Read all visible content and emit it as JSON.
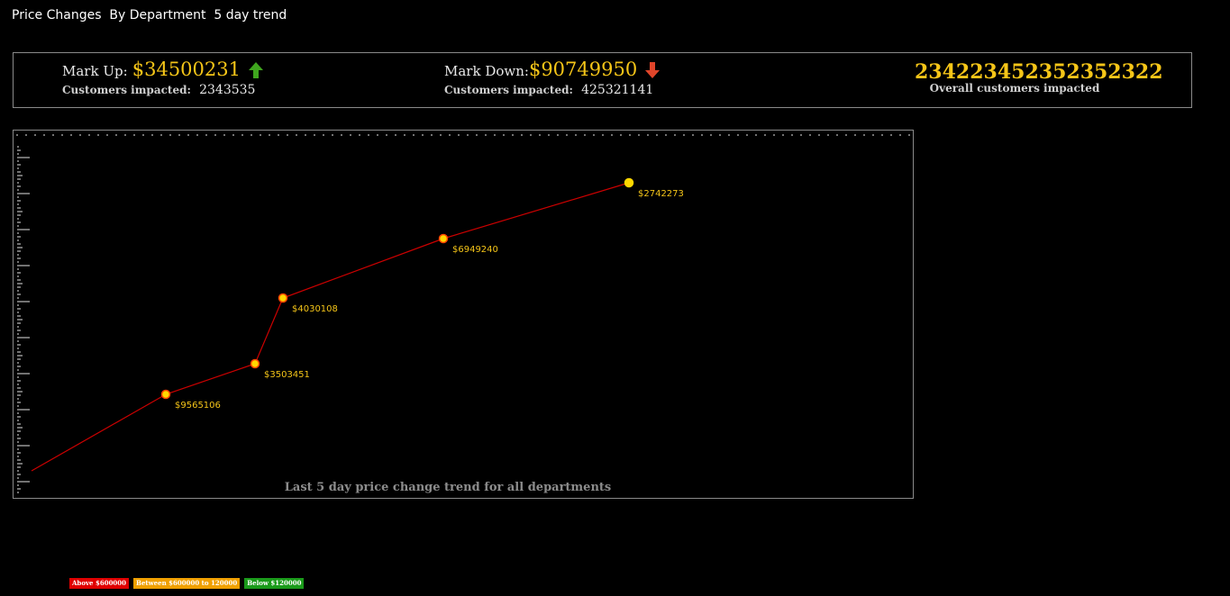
{
  "page": {
    "title": "Price Changes  By Department  5 day trend"
  },
  "summary": {
    "markup": {
      "label": "Mark Up:",
      "value": "$34500231",
      "customers_label": "Customers impacted:",
      "customers_value": "2343535",
      "arrow_color": "#3fa51e",
      "arrow_icon": "arrow-up-icon"
    },
    "markdown": {
      "label": "Mark Down:",
      "value": "$90749950",
      "customers_label": "Customers impacted:",
      "customers_value": "425321141",
      "arrow_color": "#e0452a",
      "arrow_icon": "arrow-down-icon"
    },
    "overall": {
      "value": "234223452352352322",
      "label": "Overall customers impacted"
    }
  },
  "chart_data": {
    "type": "line",
    "title": "Last 5 day price change trend for all departments",
    "xlabel": "",
    "ylabel": "",
    "grid": false,
    "line_color": "#cc0000",
    "point_fill": "#ffd700",
    "point_stroke": "#ff4400",
    "series": [
      {
        "values_plot_order": [
          0,
          1,
          2,
          3,
          4,
          5
        ],
        "labels": [
          "",
          "$9565106",
          "$3503451",
          "$4030108",
          "$6949240",
          "$2742273"
        ]
      }
    ]
  },
  "legend": {
    "items": [
      {
        "label": "Above $600000",
        "color": "#e00000"
      },
      {
        "label": "Between $600000 to 120000",
        "color": "#f0a000"
      },
      {
        "label": "Below $120000",
        "color": "#1a9a1a"
      }
    ]
  }
}
